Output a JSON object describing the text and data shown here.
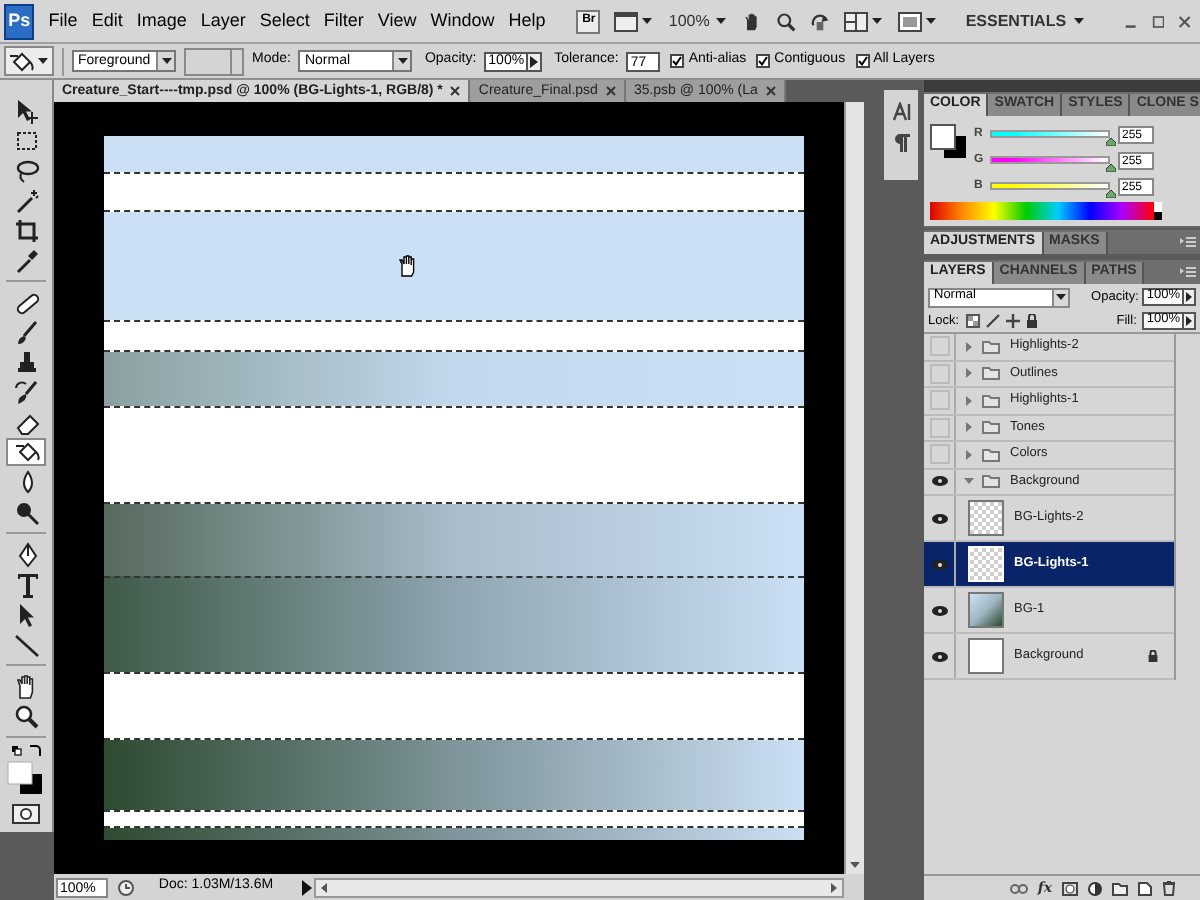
{
  "menu_bar": {
    "app_badge": "Ps",
    "items": [
      "File",
      "Edit",
      "Image",
      "Layer",
      "Select",
      "Filter",
      "View",
      "Window",
      "Help"
    ],
    "bridge_badge": "Br",
    "zoom": "100%",
    "workspace": "ESSENTIALS"
  },
  "options_bar": {
    "fill_source": "Foreground",
    "mode_label": "Mode:",
    "mode": "Normal",
    "opacity_label": "Opacity:",
    "opacity": "100%",
    "tolerance_label": "Tolerance:",
    "tolerance": "77",
    "checkboxes": [
      {
        "label": "Anti-alias",
        "checked": true
      },
      {
        "label": "Contiguous",
        "checked": true
      },
      {
        "label": "All Layers",
        "checked": true
      }
    ]
  },
  "toolbox": {
    "tools": [
      {
        "selected": false
      },
      {
        "selected": false
      },
      {
        "selected": false
      },
      {
        "selected": false
      },
      {
        "selected": false
      },
      {
        "selected": false
      },
      {
        "selected": false
      },
      {
        "selected": false
      },
      {
        "selected": false
      },
      {
        "selected": false
      },
      {
        "selected": false
      },
      {
        "selected": true
      },
      {
        "selected": false
      },
      {
        "selected": false
      },
      {
        "selected": false
      },
      {
        "selected": false
      },
      {
        "selected": false
      },
      {
        "selected": false
      },
      {
        "selected": false
      },
      {
        "selected": false
      }
    ]
  },
  "document_tabs": [
    {
      "title": "Creature_Start----tmp.psd @ 100% (BG-Lights-1, RGB/8) *",
      "selected": true
    },
    {
      "title": "Creature_Final.psd",
      "selected": false
    },
    {
      "title": "35.psb @ 100% (La",
      "selected": false
    }
  ],
  "status_bar": {
    "zoom": "100%",
    "doc_info": "Doc: 1.03M/13.6M"
  },
  "color_panel": {
    "tabs": [
      {
        "label": "COLOR",
        "selected": true
      },
      {
        "label": "SWATCH",
        "selected": false
      },
      {
        "label": "STYLES",
        "selected": false
      },
      {
        "label": "CLONE S",
        "selected": false
      }
    ],
    "channels": [
      {
        "label": "R",
        "value": "255",
        "level": 1,
        "color": "#00ffff"
      },
      {
        "label": "G",
        "value": "255",
        "level": 1,
        "color": "#ff00ff"
      },
      {
        "label": "B",
        "value": "255",
        "level": 1,
        "color": "#ffff00"
      }
    ]
  },
  "adjustments_panel": {
    "tabs": [
      {
        "label": "ADJUSTMENTS",
        "selected": true
      },
      {
        "label": "MASKS",
        "selected": false
      }
    ]
  },
  "layers_panel": {
    "tabs": [
      {
        "label": "LAYERS",
        "selected": true
      },
      {
        "label": "CHANNELS",
        "selected": false
      },
      {
        "label": "PATHS",
        "selected": false
      }
    ],
    "blend_mode": "Normal",
    "opacity_label": "Opacity:",
    "opacity": "100%",
    "lock_label": "Lock:",
    "fill_label": "Fill:",
    "fill": "100%",
    "effects_button": "fx",
    "layers": [
      {
        "name": "Highlights-2",
        "kind": "group",
        "visible": false,
        "expanded": false,
        "selected": false
      },
      {
        "name": "Outlines",
        "kind": "group",
        "visible": false,
        "expanded": false,
        "selected": false
      },
      {
        "name": "Highlights-1",
        "kind": "group",
        "visible": false,
        "expanded": false,
        "selected": false
      },
      {
        "name": "Tones",
        "kind": "group",
        "visible": false,
        "expanded": false,
        "selected": false
      },
      {
        "name": "Colors",
        "kind": "group",
        "visible": false,
        "expanded": false,
        "selected": false
      },
      {
        "name": "Background",
        "kind": "group",
        "visible": true,
        "expanded": true,
        "selected": false,
        "children": [
          {
            "name": "BG-Lights-2",
            "kind": "transparent",
            "visible": true,
            "selected": false,
            "locked": false
          },
          {
            "name": "BG-Lights-1",
            "kind": "transparent",
            "visible": true,
            "selected": true,
            "locked": false
          },
          {
            "name": "BG-1",
            "kind": "gradient",
            "visible": true,
            "selected": false,
            "locked": false
          },
          {
            "name": "Background",
            "kind": "white",
            "visible": true,
            "selected": false,
            "locked": true
          }
        ]
      }
    ]
  }
}
